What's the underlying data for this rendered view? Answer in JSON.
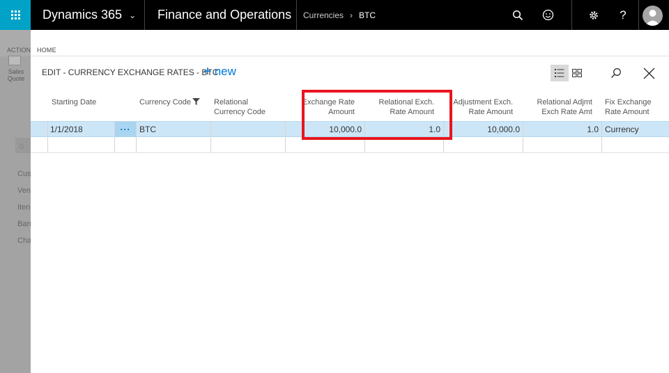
{
  "topbar": {
    "app_name": "Dynamics 365",
    "module": "Finance and Operations",
    "breadcrumb": [
      "Currencies",
      "BTC"
    ]
  },
  "background": {
    "action_label": "ACTION",
    "sales_quote_label": "Sales Quote",
    "nav_items": [
      "Cus",
      "Ven",
      "Iten",
      "Ban",
      "Cha"
    ]
  },
  "dialog": {
    "home_label": "HOME",
    "title": "EDIT - CURRENCY EXCHANGE RATES - BTC",
    "new_label": "new"
  },
  "table": {
    "headers": {
      "starting_date": "Starting Date",
      "currency_code": "Currency Code",
      "relational_currency_code_1": "Relational",
      "relational_currency_code_2": "Currency Code",
      "exchange_rate_amount_1": "Exchange Rate",
      "exchange_rate_amount_2": "Amount",
      "relational_exch_rate_amount_1": "Relational Exch.",
      "relational_exch_rate_amount_2": "Rate Amount",
      "adjustment_exch_rate_amount_1": "Adjustment Exch.",
      "adjustment_exch_rate_amount_2": "Rate Amount",
      "relational_adjmt_1": "Relational Adjmt",
      "relational_adjmt_2": "Exch Rate Amt",
      "fix_exchange_rate_amount_1": "Fix Exchange",
      "fix_exchange_rate_amount_2": "Rate Amount"
    },
    "rows": [
      {
        "starting_date": "1/1/2018",
        "more": "···",
        "currency_code": "BTC",
        "relational_currency_code": "",
        "exchange_rate_amount": "10,000.0",
        "relational_exch_rate_amount": "1.0",
        "adjustment_exch_rate_amount": "10,000.0",
        "relational_adjmt_exch_rate_amt": "1.0",
        "fix_exchange_rate_amount": "Currency"
      }
    ]
  },
  "colors": {
    "accent": "#0078d7",
    "waffle": "#00a2c7",
    "selected_row": "#cde6f7",
    "highlight_box": "#e8151f"
  }
}
